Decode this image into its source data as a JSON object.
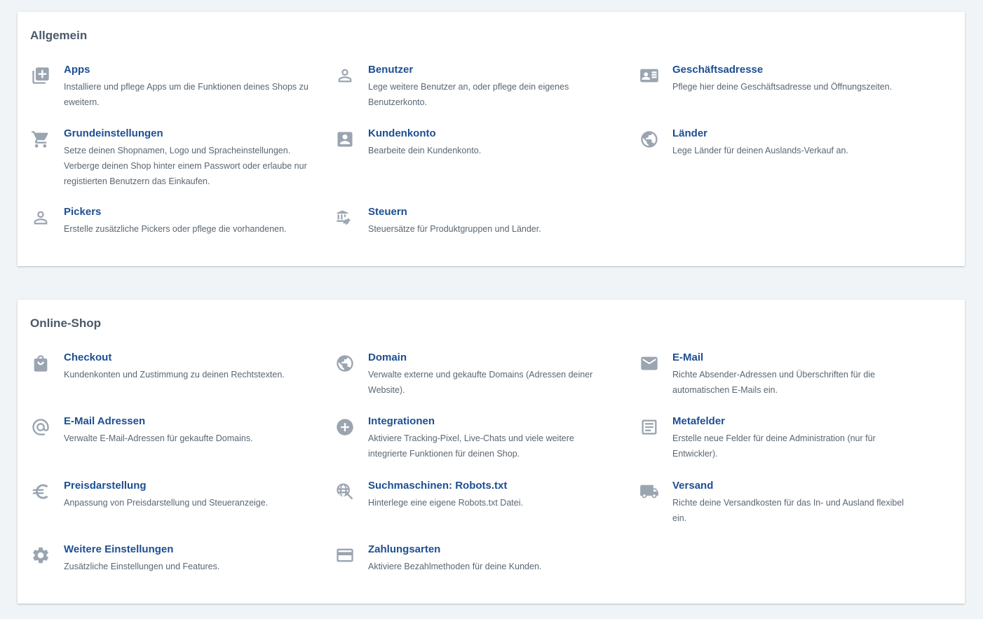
{
  "sections": [
    {
      "title": "Allgemein",
      "items": [
        {
          "title": "Apps",
          "desc": "Installiere und pflege Apps um die Funktionen deines Shops zu eweitern.",
          "icon": "add-box-icon"
        },
        {
          "title": "Benutzer",
          "desc": "Lege weitere Benutzer an, oder pflege dein eigenes Benutzerkonto.",
          "icon": "person-outline-icon"
        },
        {
          "title": "Geschäftsadresse",
          "desc": "Pflege hier deine Geschäftsadresse und Öffnungszeiten.",
          "icon": "contact-card-icon"
        },
        {
          "title": "Grundeinstellungen",
          "desc": "Setze deinen Shopnamen, Logo und Spracheinstellungen. Verberge deinen Shop hinter einem Passwort oder erlaube nur registierten Benutzern das Einkaufen.",
          "icon": "shopping-cart-icon"
        },
        {
          "title": "Kundenkonto",
          "desc": "Bearbeite dein Kundenkonto.",
          "icon": "account-box-icon"
        },
        {
          "title": "Länder",
          "desc": "Lege Länder für deinen Auslands-Verkauf an.",
          "icon": "globe-icon"
        },
        {
          "title": "Pickers",
          "desc": "Erstelle zusätzliche Pickers oder pflege die vorhandenen.",
          "icon": "person-outline-icon"
        },
        {
          "title": "Steuern",
          "desc": "Steuersätze für Produktgruppen und Länder.",
          "icon": "bank-transfer-icon"
        }
      ]
    },
    {
      "title": "Online-Shop",
      "items": [
        {
          "title": "Checkout",
          "desc": "Kundenkonten und Zustimmung zu deinen Rechtstexten.",
          "icon": "shopping-bag-icon"
        },
        {
          "title": "Domain",
          "desc": "Verwalte externe und gekaufte Domains (Adressen deiner Website).",
          "icon": "globe-icon"
        },
        {
          "title": "E-Mail",
          "desc": "Richte Absender-Adressen und Überschriften für die automatischen E-Mails ein.",
          "icon": "mail-icon"
        },
        {
          "title": "E-Mail Adressen",
          "desc": "Verwalte E-Mail-Adressen für gekaufte Domains.",
          "icon": "at-sign-icon"
        },
        {
          "title": "Integrationen",
          "desc": "Aktiviere Tracking-Pixel, Live-Chats und viele weitere integrierte Funktionen für deinen Shop.",
          "icon": "add-circle-icon"
        },
        {
          "title": "Metafelder",
          "desc": "Erstelle neue Felder für deine Administration (nur für Entwickler).",
          "icon": "text-box-icon"
        },
        {
          "title": "Preisdarstellung",
          "desc": "Anpassung von Preisdarstellung und Steueranzeige.",
          "icon": "euro-icon"
        },
        {
          "title": "Suchmaschinen: Robots.txt",
          "desc": "Hinterlege eine eigene Robots.txt Datei.",
          "icon": "globe-search-icon"
        },
        {
          "title": "Versand",
          "desc": "Richte deine Versandkosten für das In- und Ausland flexibel ein.",
          "icon": "truck-icon"
        },
        {
          "title": "Weitere Einstellungen",
          "desc": "Zusätzliche Einstellungen und Features.",
          "icon": "gear-icon"
        },
        {
          "title": "Zahlungsarten",
          "desc": "Aktiviere Bezahlmethoden für deine Kunden.",
          "icon": "credit-card-icon"
        }
      ]
    }
  ]
}
